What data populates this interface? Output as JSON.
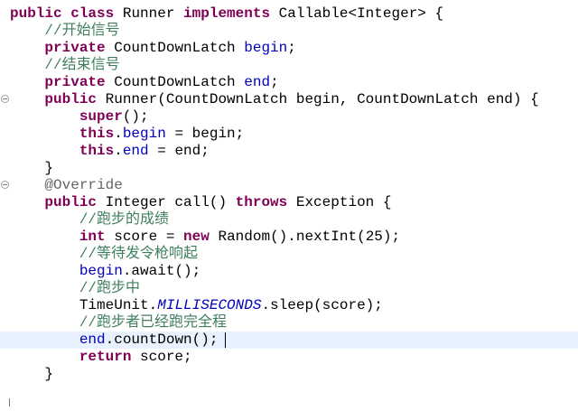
{
  "editor": {
    "language": "java",
    "colors": {
      "keyword": "#7f0055",
      "comment": "#3f7f5f",
      "field": "#0000c0",
      "annotation": "#646464",
      "plain": "#000000",
      "current_line": "#e8f2fe"
    },
    "lines": [
      [
        [
          "kw",
          "public"
        ],
        [
          "pl",
          " "
        ],
        [
          "kw",
          "class"
        ],
        [
          "pl",
          " Runner "
        ],
        [
          "kw",
          "implements"
        ],
        [
          "pl",
          " Callable<Integer> {"
        ]
      ],
      [
        [
          "pl",
          "    "
        ],
        [
          "cm",
          "//开始信号"
        ]
      ],
      [
        [
          "pl",
          "    "
        ],
        [
          "kw",
          "private"
        ],
        [
          "pl",
          " CountDownLatch "
        ],
        [
          "fd",
          "begin"
        ],
        [
          "pl",
          ";"
        ]
      ],
      [
        [
          "pl",
          "    "
        ],
        [
          "cm",
          "//结束信号"
        ]
      ],
      [
        [
          "pl",
          "    "
        ],
        [
          "kw",
          "private"
        ],
        [
          "pl",
          " CountDownLatch "
        ],
        [
          "fd",
          "end"
        ],
        [
          "pl",
          ";"
        ]
      ],
      [
        [
          "pl",
          "    "
        ],
        [
          "kw",
          "public"
        ],
        [
          "pl",
          " Runner(CountDownLatch begin, CountDownLatch end) {"
        ]
      ],
      [
        [
          "pl",
          "        "
        ],
        [
          "kw",
          "super"
        ],
        [
          "pl",
          "();"
        ]
      ],
      [
        [
          "pl",
          "        "
        ],
        [
          "kw",
          "this"
        ],
        [
          "pl",
          "."
        ],
        [
          "fd",
          "begin"
        ],
        [
          "pl",
          " = begin;"
        ]
      ],
      [
        [
          "pl",
          "        "
        ],
        [
          "kw",
          "this"
        ],
        [
          "pl",
          "."
        ],
        [
          "fd",
          "end"
        ],
        [
          "pl",
          " = end;"
        ]
      ],
      [
        [
          "pl",
          "    }"
        ]
      ],
      [
        [
          "pl",
          "    "
        ],
        [
          "an",
          "@Override"
        ]
      ],
      [
        [
          "pl",
          "    "
        ],
        [
          "kw",
          "public"
        ],
        [
          "pl",
          " Integer call() "
        ],
        [
          "kw",
          "throws"
        ],
        [
          "pl",
          " Exception {"
        ]
      ],
      [
        [
          "pl",
          "        "
        ],
        [
          "cm",
          "//跑步的成绩"
        ]
      ],
      [
        [
          "pl",
          "        "
        ],
        [
          "kw",
          "int"
        ],
        [
          "pl",
          " score = "
        ],
        [
          "kw",
          "new"
        ],
        [
          "pl",
          " Random().nextInt(25);"
        ]
      ],
      [
        [
          "pl",
          "        "
        ],
        [
          "cm",
          "//等待发令枪响起"
        ]
      ],
      [
        [
          "pl",
          "        "
        ],
        [
          "fd",
          "begin"
        ],
        [
          "pl",
          ".await();"
        ]
      ],
      [
        [
          "pl",
          "        "
        ],
        [
          "cm",
          "//跑步中"
        ]
      ],
      [
        [
          "pl",
          "        TimeUnit."
        ],
        [
          "st",
          "MILLISECONDS"
        ],
        [
          "pl",
          ".sleep(score);"
        ]
      ],
      [
        [
          "pl",
          "        "
        ],
        [
          "cm",
          "//跑步者已经跑完全程"
        ]
      ],
      [
        [
          "pl",
          "        "
        ],
        [
          "fd",
          "end"
        ],
        [
          "pl",
          ".countDown();"
        ]
      ],
      [
        [
          "pl",
          "        "
        ],
        [
          "kw",
          "return"
        ],
        [
          "pl",
          " score;"
        ]
      ],
      [
        [
          "pl",
          "    }"
        ]
      ]
    ],
    "current_line_index": 19
  }
}
